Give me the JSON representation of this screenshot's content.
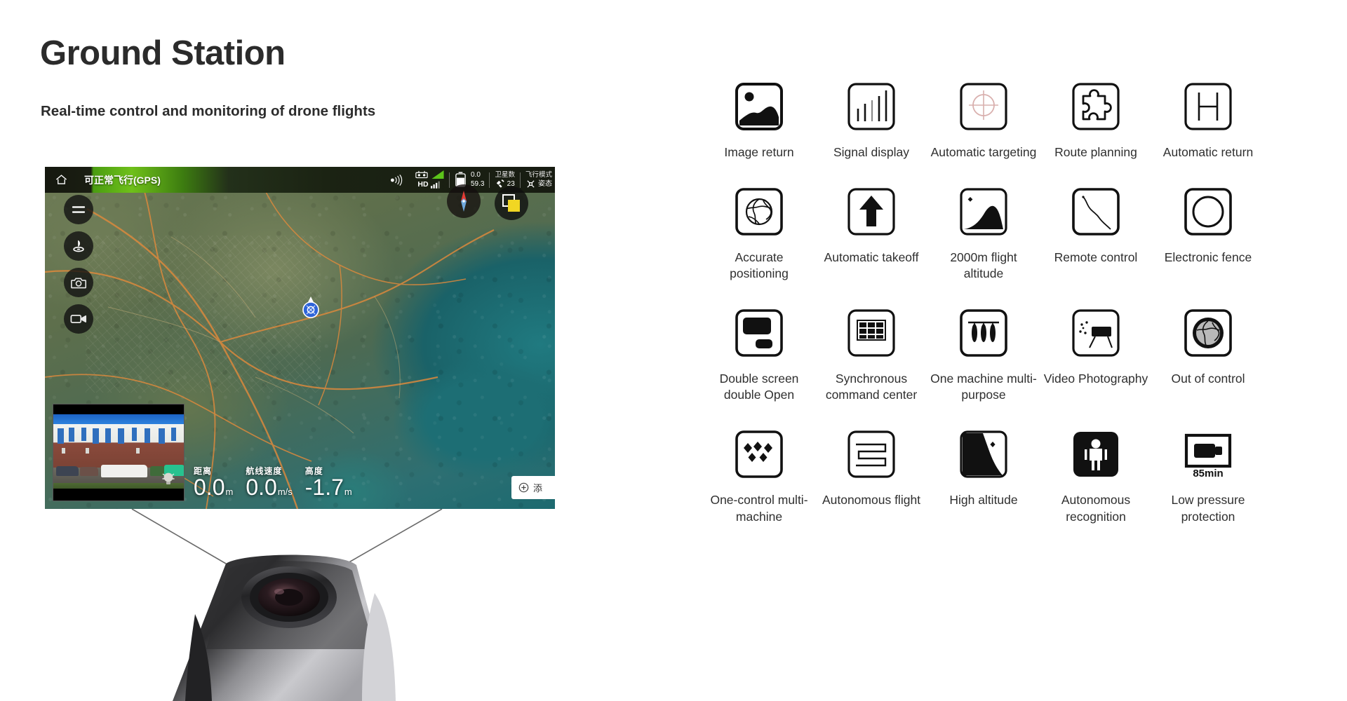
{
  "header": {
    "title": "Ground Station",
    "subtitle": "Real-time control and monitoring of drone flights"
  },
  "tablet": {
    "status_bar": {
      "home_icon": "home-icon",
      "flight_status": "可正常飞行(GPS)",
      "signal_icon": "rc-signal-icon",
      "controller_icon": "remote-controller-icon",
      "hd_label": "HD",
      "hd_signal_icon": "hd-signal-icon",
      "battery_icon": "battery-icon",
      "battery_value_top": "0.0",
      "battery_value_bottom": "59.3",
      "satellite_label": "卫星数",
      "satellite_icon": "satellite-icon",
      "satellite_count": "23",
      "flight_mode_label": "飞行模式",
      "flight_mode_icon": "drone-icon",
      "flight_mode_value": "姿态"
    },
    "map_tools": [
      {
        "name": "menu-button",
        "icon": "hamburger-menu-icon"
      },
      {
        "name": "landing-button",
        "icon": "drone-landing-icon"
      },
      {
        "name": "camera-button",
        "icon": "camera-icon"
      },
      {
        "name": "video-button",
        "icon": "video-camera-icon"
      }
    ],
    "compass": {
      "name": "compass-widget",
      "icon": "compass-needle-icon"
    },
    "layers": {
      "name": "layer-switch-button",
      "icon": "layers-swap-icon"
    },
    "drone_marker": {
      "name": "drone-position-marker",
      "icon": "drone-marker-icon"
    },
    "pip": {
      "name": "camera-preview",
      "bulb_icon": "light-bulb-icon"
    },
    "telemetry": [
      {
        "label": "距离",
        "value": "0.0",
        "unit": "m"
      },
      {
        "label": "航线速度",
        "value": "0.0",
        "unit": "m/s"
      },
      {
        "label": "高度",
        "value": "-1.7",
        "unit": "m"
      }
    ],
    "add_button": {
      "icon": "plus-circle-icon",
      "label": "添"
    }
  },
  "features": [
    {
      "label": "Image return",
      "icon": "image-return-icon"
    },
    {
      "label": "Signal display",
      "icon": "signal-bars-icon"
    },
    {
      "label": "Automatic targeting",
      "icon": "crosshair-target-icon"
    },
    {
      "label": "Route planning",
      "icon": "puzzle-piece-icon"
    },
    {
      "label": "Automatic return",
      "icon": "helipad-h-icon"
    },
    {
      "label": "Accurate positioning",
      "icon": "globe-icon"
    },
    {
      "label": "Automatic takeoff",
      "icon": "up-arrow-icon"
    },
    {
      "label": "2000m flight altitude",
      "icon": "mountain-peak-icon"
    },
    {
      "label": "Remote control",
      "icon": "flight-path-curve-icon"
    },
    {
      "label": "Electronic fence",
      "icon": "circle-fence-icon"
    },
    {
      "label": "Double screen double Open",
      "icon": "dual-screen-icon"
    },
    {
      "label": "Synchronous command center",
      "icon": "grid-panel-icon"
    },
    {
      "label": "One machine multi-purpose",
      "icon": "payload-rack-icon"
    },
    {
      "label": "Video Photography",
      "icon": "projector-screen-icon"
    },
    {
      "label": "Out of control",
      "icon": "globe-ring-icon"
    },
    {
      "label": "One-control multi-machine",
      "icon": "multi-drone-icon"
    },
    {
      "label": "Autonomous flight",
      "icon": "serpentine-route-icon"
    },
    {
      "label": "High altitude",
      "icon": "cliff-star-icon"
    },
    {
      "label": "Autonomous recognition",
      "icon": "person-recognition-icon"
    },
    {
      "label": "Low pressure protection",
      "icon": "battery-85min-icon",
      "badge": "85min"
    }
  ],
  "colors": {
    "title": "#2b2b2b",
    "status_green": "#6fc01a",
    "icon_stroke": "#111111",
    "label_text": "#2f2f2f"
  }
}
